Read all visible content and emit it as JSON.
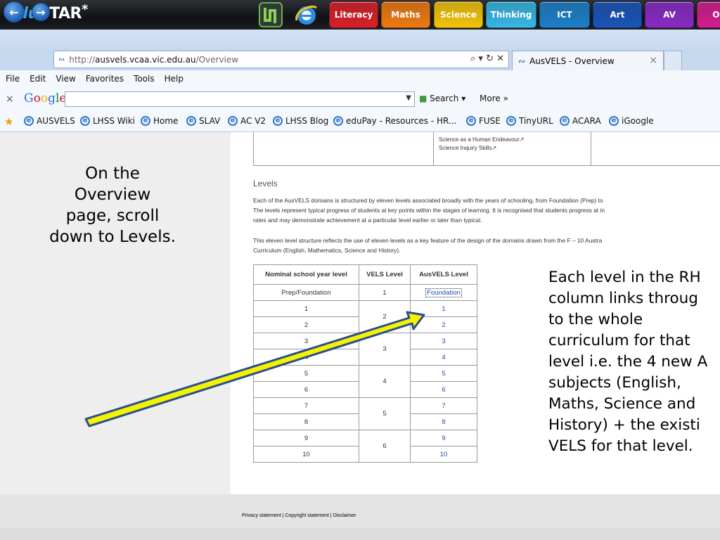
{
  "edustar": {
    "logo_edu": "edu",
    "logo_star": "STAR",
    "logo_asterisk": "*",
    "tabs": [
      {
        "label": "Literacy",
        "color": "#d8212a"
      },
      {
        "label": "Maths",
        "color": "#ee7a12"
      },
      {
        "label": "Science",
        "color": "#f2c40a"
      },
      {
        "label": "Thinking",
        "color": "#38b6e3"
      },
      {
        "label": "ICT",
        "color": "#1e7fc9"
      },
      {
        "label": "Art",
        "color": "#1b55b8"
      },
      {
        "label": "AV",
        "color": "#8a2bc4"
      },
      {
        "label": "Of",
        "color": "#d21f8f"
      }
    ]
  },
  "browser": {
    "url_prefix": "http://",
    "url_host": "ausvels.vcaa.vic.edu.au",
    "url_path": "/Overview",
    "url_tools": "⌕ ▾ ↻ ✕",
    "tab_title": "AusVELS - Overview",
    "tab_close": "×",
    "menu": [
      "File",
      "Edit",
      "View",
      "Favorites",
      "Tools",
      "Help"
    ],
    "google": {
      "close": "×",
      "search_label": "Search",
      "more_label": "More »"
    },
    "favorites": [
      "AUSVELS",
      "LHSS Wiki",
      "Home",
      "SLAV",
      "AC V2",
      "LHSS Blog",
      "eduPay - Resources - HR...",
      "FUSE",
      "TinyURL",
      "ACARA",
      "iGoogle"
    ]
  },
  "page": {
    "top_table_lines": [
      "Science as a Human Endeavour↗",
      "Science Inquiry Skills↗"
    ],
    "levels_heading": "Levels",
    "para_1_lines": [
      "Each of the AusVELS domains is structured by eleven levels associated broadly with the years of schooling, from Foundation (Prep) to",
      "The levels represent typical progress of students at key points within the stages of learning. It is recognised that students progress at in",
      "rates and may demonstrate achievement at a particular level earlier or later than typical."
    ],
    "para_2_lines": [
      "This eleven level structure reflects the use of eleven levels as a key feature of the design of the domains drawn from the F – 10 Austra",
      "Curriculum (English, Mathematics, Science and History)."
    ],
    "table": {
      "headers": [
        "Nominal school year level",
        "VELS Level",
        "AusVELS Level"
      ],
      "years": [
        "Prep/Foundation",
        "1",
        "2",
        "3",
        "4",
        "5",
        "6",
        "7",
        "8",
        "9",
        "10"
      ],
      "vels": [
        "1",
        "2",
        "3",
        "4",
        "5",
        "6"
      ],
      "ausvels": [
        "Foundation",
        "1",
        "2",
        "3",
        "4",
        "5",
        "6",
        "7",
        "8",
        "9",
        "10"
      ]
    },
    "footer_links": "Privacy statement | Copyright statement | Disclaimer"
  },
  "annotations": {
    "left_caption": "On the Overview page, scroll down to Levels.",
    "right_caption_lines": [
      "Each level in the RH",
      "column links throug",
      "to the whole",
      "curriculum for that",
      "level i.e. the 4 new A",
      "subjects (English,",
      "Maths, Science and",
      "History) + the existi",
      "VELS for that level."
    ],
    "arrow_color": "#f5f200"
  }
}
